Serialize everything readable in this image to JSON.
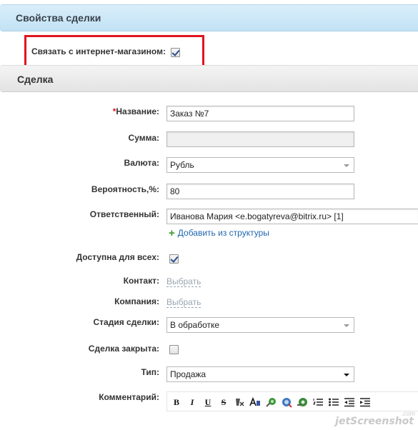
{
  "properties_header": {
    "title": "Свойства сделки"
  },
  "link_store": {
    "label": "Связать с интернет-магазином:",
    "checked": true
  },
  "deal_header": {
    "title": "Сделка"
  },
  "fields": {
    "name": {
      "required_mark": "*",
      "label": "Название:",
      "value": "Заказ №7"
    },
    "sum": {
      "label": "Сумма:",
      "value": ""
    },
    "currency": {
      "label": "Валюта:",
      "value": "Рубль"
    },
    "probability": {
      "label": "Вероятность,%:",
      "value": "80"
    },
    "responsible": {
      "label": "Ответственный:",
      "value": "Иванова Мария <e.bogatyreva@bitrix.ru> [1]",
      "add_link": "Добавить из структуры"
    },
    "available_all": {
      "label": "Доступна для всех:",
      "checked": true
    },
    "contact": {
      "label": "Контакт:",
      "choose": "Выбрать"
    },
    "company": {
      "label": "Компания:",
      "choose": "Выбрать"
    },
    "stage": {
      "label": "Стадия сделки:",
      "value": "В обработке"
    },
    "closed": {
      "label": "Сделка закрыта:",
      "checked": false
    },
    "type": {
      "label": "Тип:",
      "value": "Продажа"
    },
    "comment": {
      "label": "Комментарий:"
    }
  },
  "toolbar": {
    "bold": "B",
    "italic": "I",
    "underline": "U",
    "strike": "S",
    "icons": [
      "bold-icon",
      "italic-icon",
      "underline-icon",
      "strikethrough-icon",
      "remove-format-icon",
      "font-style-icon",
      "insert-link-icon",
      "remove-link-icon",
      "insert-image-icon",
      "ordered-list-icon",
      "unordered-list-icon",
      "outdent-icon",
      "indent-icon"
    ]
  },
  "watermark": {
    "text": "jetScreenshot",
    "suffix": ".com"
  }
}
